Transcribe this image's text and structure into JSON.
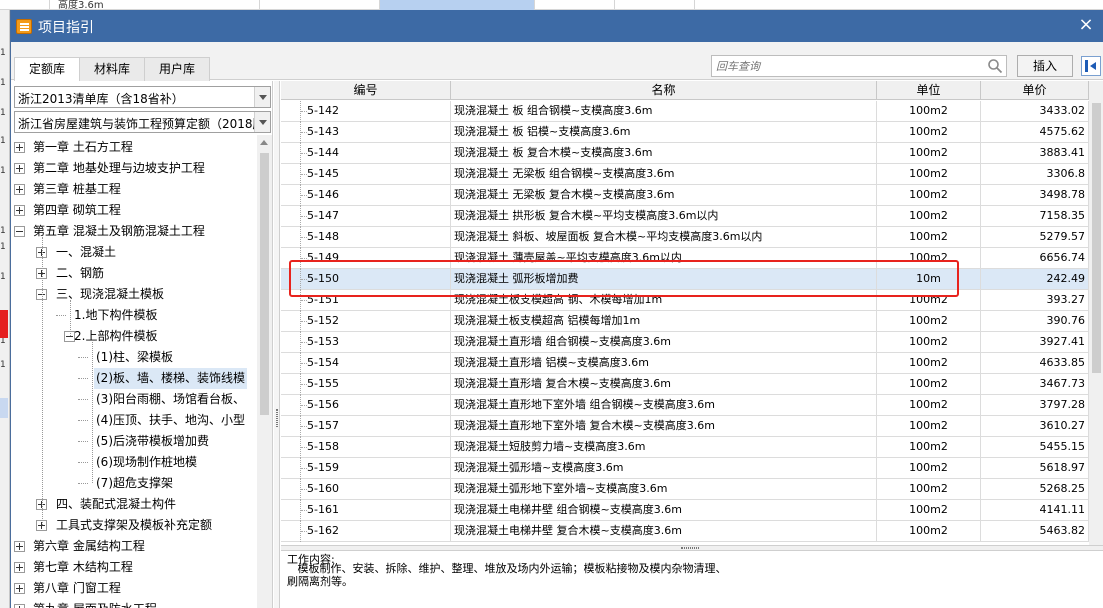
{
  "background": {
    "top_cell_text": "高度3.6m",
    "left_numbers": [
      "1",
      "1",
      "1",
      "1",
      "1",
      "1",
      "1",
      "1",
      "1",
      "1"
    ]
  },
  "dialog": {
    "title": "项目指引",
    "close_label": "×"
  },
  "tabs": [
    {
      "label": "定额库",
      "active": true
    },
    {
      "label": "材料库",
      "active": false
    },
    {
      "label": "用户库",
      "active": false
    }
  ],
  "search": {
    "placeholder": "回车查询",
    "value": ""
  },
  "insert_label": "插入",
  "combos": {
    "library": "浙江2013清单库（含18省补）",
    "quota_set": "浙江省房屋建筑与装饰工程预算定额（2018版）"
  },
  "tree": [
    {
      "label": "第一章  土石方工程",
      "level": 0,
      "state": "plus"
    },
    {
      "label": "第二章  地基处理与边坡支护工程",
      "level": 0,
      "state": "plus"
    },
    {
      "label": "第三章  桩基工程",
      "level": 0,
      "state": "plus"
    },
    {
      "label": "第四章  砌筑工程",
      "level": 0,
      "state": "plus"
    },
    {
      "label": "第五章  混凝土及钢筋混凝土工程",
      "level": 0,
      "state": "minus"
    },
    {
      "label": "一、混凝土",
      "level": 1,
      "state": "plus"
    },
    {
      "label": "二、钢筋",
      "level": 1,
      "state": "plus"
    },
    {
      "label": "三、现浇混凝土模板",
      "level": 1,
      "state": "minus"
    },
    {
      "label": "1.地下构件模板",
      "level": 2,
      "state": "none"
    },
    {
      "label": "2.上部构件模板",
      "level": 2,
      "state": "minus"
    },
    {
      "label": "(1)柱、梁模板",
      "level": 3,
      "state": "none"
    },
    {
      "label": "(2)板、墙、楼梯、装饰线模",
      "level": 3,
      "state": "none",
      "selected": true
    },
    {
      "label": "(3)阳台雨棚、场馆看台板、",
      "level": 3,
      "state": "none"
    },
    {
      "label": "(4)压顶、扶手、地沟、小型",
      "level": 3,
      "state": "none"
    },
    {
      "label": "(5)后浇带模板增加费",
      "level": 3,
      "state": "none"
    },
    {
      "label": "(6)现场制作桩地模",
      "level": 3,
      "state": "none"
    },
    {
      "label": "(7)超危支撑架",
      "level": 3,
      "state": "none"
    },
    {
      "label": "四、装配式混凝土构件",
      "level": 1,
      "state": "plus"
    },
    {
      "label": "工具式支撑架及模板补充定额",
      "level": 1,
      "state": "plus"
    },
    {
      "label": "第六章  金属结构工程",
      "level": 0,
      "state": "plus"
    },
    {
      "label": "第七章  木结构工程",
      "level": 0,
      "state": "plus"
    },
    {
      "label": "第八章  门窗工程",
      "level": 0,
      "state": "plus"
    },
    {
      "label": "第九章  屋面及防水工程",
      "level": 0,
      "state": "plus"
    }
  ],
  "grid": {
    "headers": [
      "编号",
      "名称",
      "单位",
      "单价"
    ],
    "rows": [
      {
        "code": "5-142",
        "name": "现浇混凝土 板 组合钢模~支模高度3.6m",
        "unit": "100m2",
        "price": "3433.02"
      },
      {
        "code": "5-143",
        "name": "现浇混凝土 板 铝模~支模高度3.6m",
        "unit": "100m2",
        "price": "4575.62"
      },
      {
        "code": "5-144",
        "name": "现浇混凝土 板 复合木模~支模高度3.6m",
        "unit": "100m2",
        "price": "3883.41"
      },
      {
        "code": "5-145",
        "name": "现浇混凝土 无梁板 组合钢模~支模高度3.6m",
        "unit": "100m2",
        "price": "3306.8"
      },
      {
        "code": "5-146",
        "name": "现浇混凝土 无梁板 复合木模~支模高度3.6m",
        "unit": "100m2",
        "price": "3498.78"
      },
      {
        "code": "5-147",
        "name": "现浇混凝土 拱形板 复合木模~平均支模高度3.6m以内",
        "unit": "100m2",
        "price": "7158.35"
      },
      {
        "code": "5-148",
        "name": "现浇混凝土 斜板、坡屋面板 复合木模~平均支模高度3.6m以内",
        "unit": "100m2",
        "price": "5279.57"
      },
      {
        "code": "5-149",
        "name": "现浇混凝土 薄壳屋盖~平均支模高度3.6m以内",
        "unit": "100m2",
        "price": "6656.74"
      },
      {
        "code": "5-150",
        "name": "现浇混凝土 弧形板增加费",
        "unit": "10m",
        "price": "242.49",
        "selected": true
      },
      {
        "code": "5-151",
        "name": "现浇混凝土板支模超高 钢、木模每增加1m",
        "unit": "100m2",
        "price": "393.27"
      },
      {
        "code": "5-152",
        "name": "现浇混凝土板支模超高 铝模每增加1m",
        "unit": "100m2",
        "price": "390.76"
      },
      {
        "code": "5-153",
        "name": "现浇混凝土直形墙 组合钢模~支模高度3.6m",
        "unit": "100m2",
        "price": "3927.41"
      },
      {
        "code": "5-154",
        "name": "现浇混凝土直形墙 铝模~支模高度3.6m",
        "unit": "100m2",
        "price": "4633.85"
      },
      {
        "code": "5-155",
        "name": "现浇混凝土直形墙 复合木模~支模高度3.6m",
        "unit": "100m2",
        "price": "3467.73"
      },
      {
        "code": "5-156",
        "name": "现浇混凝土直形地下室外墙 组合钢模~支模高度3.6m",
        "unit": "100m2",
        "price": "3797.28"
      },
      {
        "code": "5-157",
        "name": "现浇混凝土直形地下室外墙 复合木模~支模高度3.6m",
        "unit": "100m2",
        "price": "3610.27"
      },
      {
        "code": "5-158",
        "name": "现浇混凝土短肢剪力墙~支模高度3.6m",
        "unit": "100m2",
        "price": "5455.15"
      },
      {
        "code": "5-159",
        "name": "现浇混凝土弧形墙~支模高度3.6m",
        "unit": "100m2",
        "price": "5618.97"
      },
      {
        "code": "5-160",
        "name": "现浇混凝土弧形地下室外墙~支模高度3.6m",
        "unit": "100m2",
        "price": "5268.25"
      },
      {
        "code": "5-161",
        "name": "现浇混凝土电梯井壁 组合钢模~支模高度3.6m",
        "unit": "100m2",
        "price": "4141.11"
      },
      {
        "code": "5-162",
        "name": "现浇混凝土电梯井壁 复合木模~支模高度3.6m",
        "unit": "100m2",
        "price": "5463.82"
      }
    ]
  },
  "description": {
    "title": "工作内容:",
    "text": "   模板制作、安装、拆除、维护、整理、堆放及场内外运输；模板粘接物及模内杂物清理、\n刷隔离剂等。"
  },
  "colors": {
    "titlebar": "#3d6aa5",
    "selection": "#dbe8f6",
    "highlight_box": "#e8231d"
  }
}
